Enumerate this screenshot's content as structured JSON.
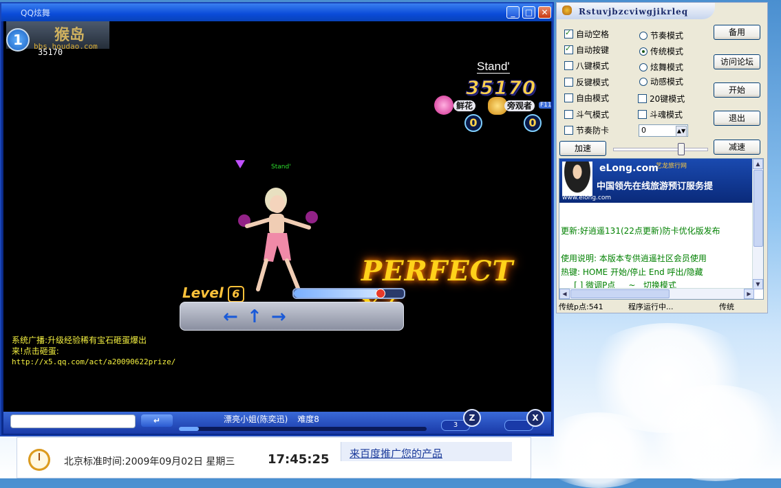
{
  "game": {
    "window_title": "QQ炫舞",
    "logo_text": "猴岛",
    "logo_url": "bbs.houdao.com",
    "player_rank": "1",
    "player_score": "35170",
    "stand_name": "Stand'",
    "big_score": "35170",
    "flower_label": "鲜花",
    "flower_count": "0",
    "spectator_label": "旁观者",
    "spectator_count": "0",
    "spectator_key": "F11",
    "avatar_name": "Stand'",
    "perfect_text": "PERFECT x7",
    "level_label": "Level",
    "level_value": "6",
    "level_progress": 0.78,
    "arrows": [
      "←",
      "↑",
      "→"
    ],
    "broadcast_line1": "系统广播:升级经验稀有宝石砸蛋爆出",
    "broadcast_line2": "来!点击砸蛋:",
    "broadcast_url": "http://x5.qq.com/act/a20090622prize/",
    "enter_label": "↵",
    "song_title": "漂亮小姐(陈奕迅)",
    "song_difficulty": "难度8",
    "song_progress": 0.08,
    "key_count": "3",
    "key_z": "Z",
    "key_x": "X"
  },
  "helper": {
    "title": "Rstuvjbzcviwgjikrleq",
    "checkboxes": [
      {
        "label": "自动空格",
        "checked": true
      },
      {
        "label": "自动按键",
        "checked": true
      },
      {
        "label": "八键模式",
        "checked": false
      },
      {
        "label": "反键模式",
        "checked": false
      },
      {
        "label": "自由模式",
        "checked": false
      },
      {
        "label": "斗气模式",
        "checked": false
      },
      {
        "label": "节奏防卡",
        "checked": false
      }
    ],
    "radios": [
      {
        "label": "节奏模式",
        "selected": false
      },
      {
        "label": "传统模式",
        "selected": true
      },
      {
        "label": "炫舞模式",
        "selected": false
      },
      {
        "label": "动感模式",
        "selected": false
      }
    ],
    "mode_checkboxes": [
      {
        "label": "20键模式",
        "checked": false
      },
      {
        "label": "斗魂模式",
        "checked": false
      }
    ],
    "buttons": {
      "backup": "备用",
      "forum": "访问论坛",
      "start": "开始",
      "exit": "退出",
      "speed_up": "加速",
      "slow_down": "减速"
    },
    "spin_value": "0",
    "speed_level": 0.72,
    "ad": {
      "brand": "eLong.com",
      "brand_sub": "艺龙旅行网",
      "slogan": "中国领先在线旅游预订服务提",
      "url": "www.elong.com"
    },
    "news": [
      "更新:好逍遥131(22点更新)防卡优化版发布",
      "使用说明: 本版本专供逍遥社区会员使用",
      "热键: HOME 开始/停止   End  呼出/隐藏",
      "     [ ] 微调P点     ~   切换模式"
    ],
    "status": {
      "points": "传统p点:541",
      "running": "程序运行中...",
      "mode": "传统"
    }
  },
  "clock": {
    "label": "北京标准时间:2009年09月02日  星期三",
    "time": "17:45:25",
    "promo": "来百度推广您的产品"
  }
}
